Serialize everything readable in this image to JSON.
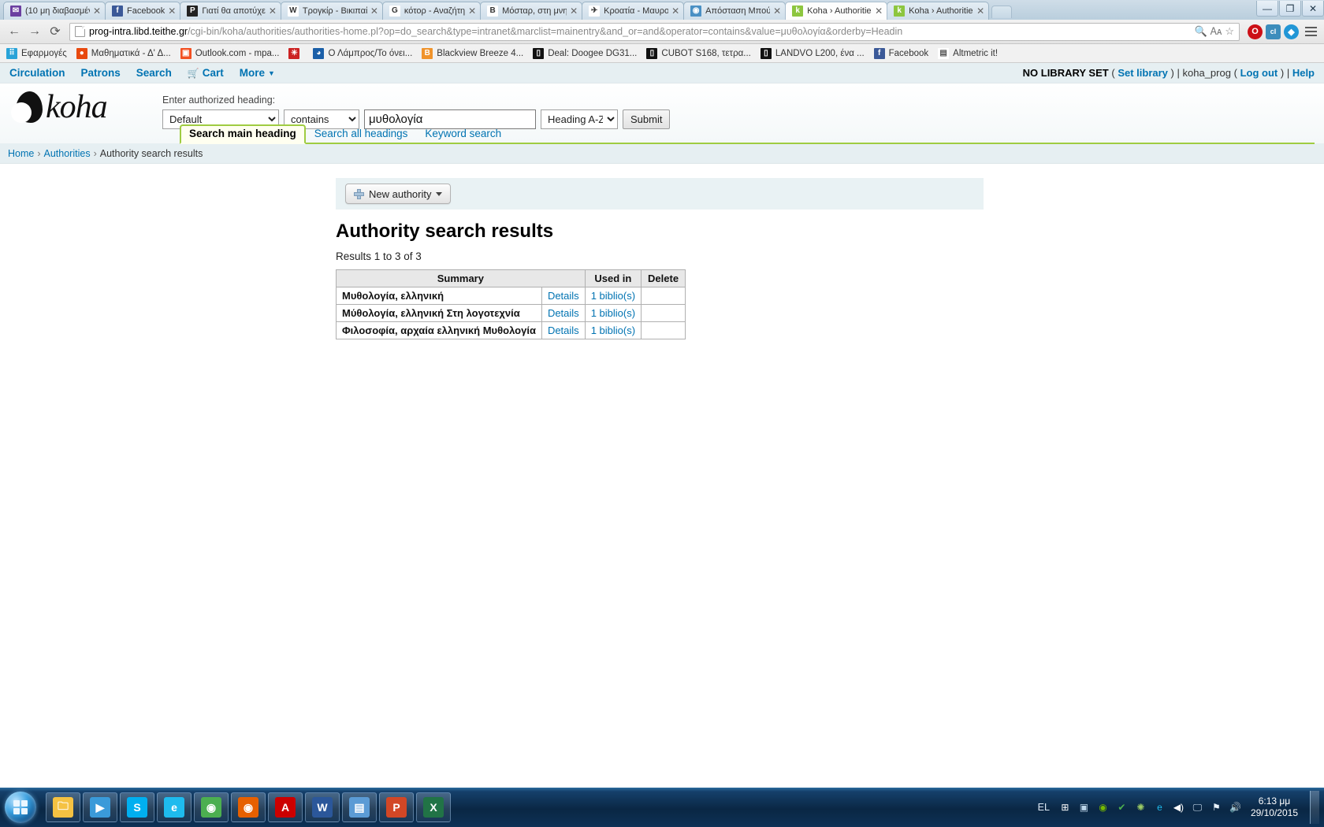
{
  "browser": {
    "tabs": [
      {
        "title": "(10 μη διαβασμέν",
        "favicon": "mail-icon",
        "color": "#6b3fa0",
        "glyph": "✉",
        "active": false
      },
      {
        "title": "Facebook",
        "favicon": "facebook-icon",
        "color": "#3b5998",
        "glyph": "f",
        "active": false
      },
      {
        "title": "Γιατί θα αποτύχε",
        "favicon": "pocket-icon",
        "color": "#222222",
        "glyph": "P",
        "active": false
      },
      {
        "title": "Τρογκίρ - Βικιπαί",
        "favicon": "wikipedia-icon",
        "color": "#ffffff",
        "glyph": "W",
        "active": false
      },
      {
        "title": "κότορ - Αναζήτη",
        "favicon": "google-icon",
        "color": "#ffffff",
        "glyph": "G",
        "active": false
      },
      {
        "title": "Μόσταρ, στη μνη",
        "favicon": "blogger-icon",
        "color": "#ffffff",
        "glyph": "B",
        "active": false
      },
      {
        "title": "Κροατία - Μαυρο",
        "favicon": "flight-icon",
        "color": "#ffffff",
        "glyph": "✈",
        "active": false
      },
      {
        "title": "Απόσταση Μπού",
        "favicon": "map-pin-icon",
        "color": "#4a90c4",
        "glyph": "◉",
        "active": false
      },
      {
        "title": "Koha › Authorities",
        "favicon": "koha-icon",
        "color": "#8dc63f",
        "glyph": "k",
        "active": true
      },
      {
        "title": "Koha › Authorities",
        "favicon": "koha-icon",
        "color": "#8dc63f",
        "glyph": "k",
        "active": false
      }
    ],
    "newtab_label": "+",
    "window_controls": [
      "minimize",
      "maximize",
      "close"
    ],
    "nav": {
      "back": "←",
      "forward": "→",
      "reload": "⟳"
    },
    "url_bold": "prog-intra.libd.teithe.gr",
    "url_rest": "/cgi-bin/koha/authorities/authorities-home.pl?op=do_search&type=intranet&marclist=mainentry&and_or=and&operator=contains&value=μυθολογία&orderby=Headin",
    "omnibox_icons": [
      "search-icon",
      "translate-icon",
      "bookmark-star-icon"
    ],
    "toolbar_extensions": [
      {
        "name": "opera-extension-icon",
        "glyph": "O",
        "color": "#cc0f16"
      },
      {
        "name": "clipboard-extension-icon",
        "glyph": "cl",
        "color": "#3c8dbc"
      },
      {
        "name": "diamond-extension-icon",
        "glyph": "◆",
        "color": "#2196d6"
      }
    ],
    "bookmarks": [
      {
        "label": "Εφαρμογές",
        "icon": "apps-grid-icon",
        "color": "#2aa3d8",
        "glyph": "⠿"
      },
      {
        "label": "Μαθηματικά - Δ' Δ...",
        "icon": "math-icon",
        "color": "#e8490f",
        "glyph": "●"
      },
      {
        "label": "Outlook.com - mpa...",
        "icon": "outlook-icon",
        "color": "#f25022",
        "glyph": "▣"
      },
      {
        "label": "",
        "icon": "red-star-icon",
        "color": "#cc2222",
        "glyph": "✳"
      },
      {
        "label": "Ο Λάμπρος/Το όνει...",
        "icon": "blue-globe-icon",
        "color": "#1b5fa8",
        "glyph": "◕"
      },
      {
        "label": "Blackview Breeze 4...",
        "icon": "orange-b-icon",
        "color": "#f0932b",
        "glyph": "B"
      },
      {
        "label": "Deal: Doogee DG31...",
        "icon": "phone-icon",
        "color": "#111111",
        "glyph": "▯"
      },
      {
        "label": "CUBOT S168, τετρα...",
        "icon": "phone-icon",
        "color": "#111111",
        "glyph": "▯"
      },
      {
        "label": "LANDVO L200, ένα ...",
        "icon": "phone-icon",
        "color": "#111111",
        "glyph": "▯"
      },
      {
        "label": "Facebook",
        "icon": "facebook-icon",
        "color": "#3b5998",
        "glyph": "f"
      },
      {
        "label": "Altmetric it!",
        "icon": "page-icon",
        "color": "#ffffff",
        "glyph": "▤"
      }
    ]
  },
  "koha": {
    "nav": {
      "circulation": "Circulation",
      "patrons": "Patrons",
      "search": "Search",
      "cart": "Cart",
      "more": "More"
    },
    "user": {
      "library": "NO LIBRARY SET",
      "open_paren": "(",
      "set_library": "Set library",
      "close_paren": ")",
      "pipe1": "|",
      "username": "koha_prog",
      "open_paren2": "(",
      "logout": "Log out",
      "close_paren2": ")",
      "pipe2": "|",
      "help": "Help"
    },
    "logo": "koha",
    "search": {
      "label": "Enter authorized heading:",
      "select_default": "Default",
      "select_operator": "contains",
      "value": "μυθολογία",
      "select_order": "Heading A-Z",
      "submit": "Submit",
      "options_default": [
        "Default"
      ],
      "options_operator": [
        "contains"
      ],
      "options_order": [
        "Heading A-Z"
      ]
    },
    "tabs": [
      {
        "label": "Search main heading",
        "active": true
      },
      {
        "label": "Search all headings",
        "active": false
      },
      {
        "label": "Keyword search",
        "active": false
      }
    ],
    "breadcrumbs": [
      "Home",
      "Authorities",
      "Authority search results"
    ],
    "toolbar": {
      "new_authority": "New authority"
    },
    "results": {
      "title": "Authority search results",
      "count_text": "Results 1 to 3 of 3",
      "columns": [
        "Summary",
        "",
        "Used in",
        "Delete"
      ],
      "rows": [
        {
          "summary": "Μυθολογία, ελληνική",
          "details": "Details",
          "used_in": "1 biblio(s)",
          "delete": ""
        },
        {
          "summary": "Μύθολογία, ελληνική Στη λογοτεχνία",
          "details": "Details",
          "used_in": "1 biblio(s)",
          "delete": ""
        },
        {
          "summary": "Φιλοσοφία, αρχαία ελληνική Μυθολογία",
          "details": "Details",
          "used_in": "1 biblio(s)",
          "delete": ""
        }
      ]
    }
  },
  "taskbar": {
    "start": "start-button",
    "apps": [
      {
        "name": "explorer-taskbar-icon",
        "glyph": "🗀",
        "color": "#f5c242"
      },
      {
        "name": "media-player-taskbar-icon",
        "glyph": "▶",
        "color": "#3a9ad9"
      },
      {
        "name": "skype-taskbar-icon",
        "glyph": "S",
        "color": "#00aff0"
      },
      {
        "name": "internet-explorer-taskbar-icon",
        "glyph": "e",
        "color": "#1ebbee"
      },
      {
        "name": "chrome-taskbar-icon",
        "glyph": "◉",
        "color": "#4caf50"
      },
      {
        "name": "firefox-taskbar-icon",
        "glyph": "◉",
        "color": "#e66000"
      },
      {
        "name": "acrobat-taskbar-icon",
        "glyph": "A",
        "color": "#cc0000"
      },
      {
        "name": "word-taskbar-icon",
        "glyph": "W",
        "color": "#2b579a"
      },
      {
        "name": "windows-explorer-taskbar-icon",
        "glyph": "▤",
        "color": "#5b9bd5"
      },
      {
        "name": "powerpoint-taskbar-icon",
        "glyph": "P",
        "color": "#d24726"
      },
      {
        "name": "excel-taskbar-icon",
        "glyph": "X",
        "color": "#217346"
      }
    ],
    "tray": {
      "language": "EL",
      "icons": [
        {
          "name": "windows-store-icon",
          "glyph": "⊞",
          "color": "#ffffff"
        },
        {
          "name": "camera-tray-icon",
          "glyph": "▣",
          "color": "#bcd6ea"
        },
        {
          "name": "nvidia-tray-icon",
          "glyph": "◉",
          "color": "#76b900"
        },
        {
          "name": "dropbox-tray-icon",
          "glyph": "✔",
          "color": "#4caf50"
        },
        {
          "name": "spider-tray-icon",
          "glyph": "✺",
          "color": "#9ccc65"
        },
        {
          "name": "edge-tray-icon",
          "glyph": "e",
          "color": "#1ebbee"
        },
        {
          "name": "volume-tray-icon",
          "glyph": "◀)",
          "color": "#ffffff"
        },
        {
          "name": "screen-tray-icon",
          "glyph": "🖵",
          "color": "#cfe3f4"
        },
        {
          "name": "flag-action-center-icon",
          "glyph": "⚑",
          "color": "#e8f2fb"
        },
        {
          "name": "speaker-tray-icon",
          "glyph": "🔊",
          "color": "#e03c31"
        }
      ],
      "time": "6:13 μμ",
      "date": "29/10/2015"
    }
  }
}
